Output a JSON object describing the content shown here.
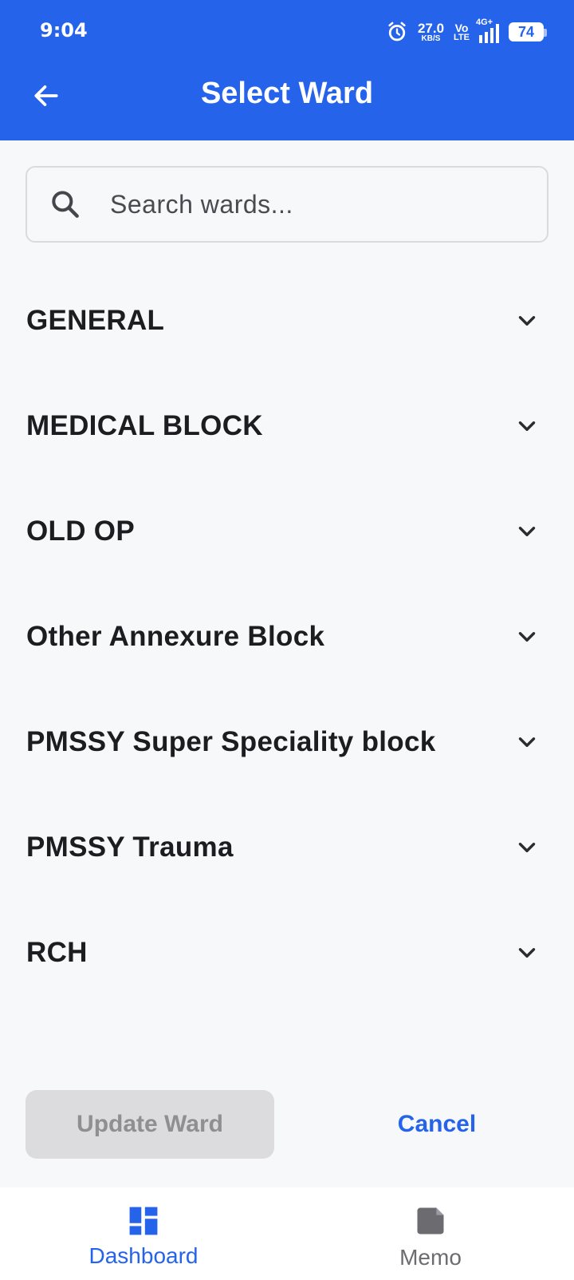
{
  "status": {
    "time": "9:04",
    "speed_value": "27.0",
    "speed_unit": "KB/S",
    "volte_top": "Vo",
    "volte_bottom": "LTE",
    "network": "4G+",
    "battery": "74"
  },
  "header": {
    "title": "Select Ward"
  },
  "search": {
    "placeholder": "Search wards...",
    "value": ""
  },
  "wards": [
    {
      "label": "GENERAL"
    },
    {
      "label": "MEDICAL BLOCK"
    },
    {
      "label": "OLD OP"
    },
    {
      "label": "Other Annexure Block"
    },
    {
      "label": "PMSSY Super Speciality block"
    },
    {
      "label": "PMSSY Trauma"
    },
    {
      "label": "RCH"
    }
  ],
  "actions": {
    "update_label": "Update Ward",
    "cancel_label": "Cancel"
  },
  "bottom_nav": {
    "items": [
      {
        "label": "Dashboard",
        "icon": "dashboard-icon",
        "active": true
      },
      {
        "label": "Memo",
        "icon": "memo-icon",
        "active": false
      }
    ]
  },
  "colors": {
    "primary": "#2563eb",
    "background": "#f7f8fa",
    "disabled_button": "#dcdcde"
  }
}
